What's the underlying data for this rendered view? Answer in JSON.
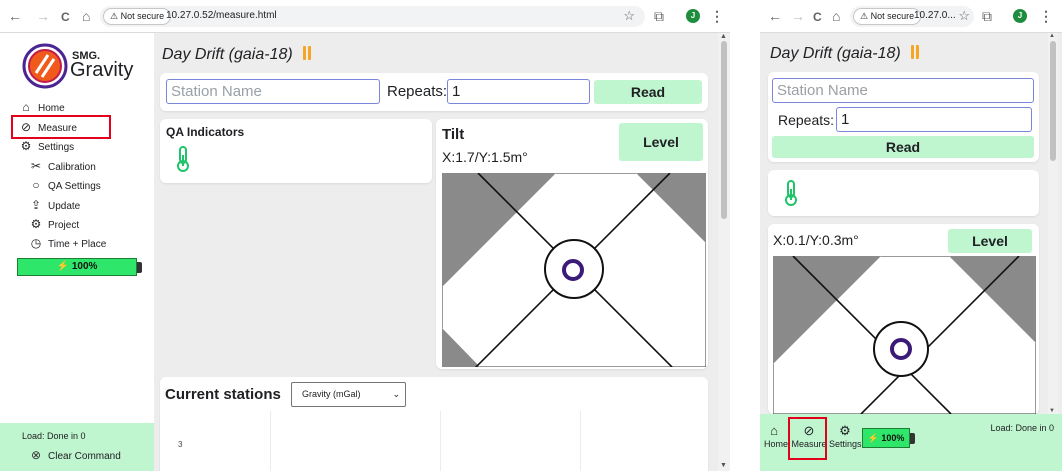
{
  "browser": {
    "back_icon": "←",
    "forward_icon": "→",
    "reload_icon": "C",
    "home_icon": "⌂",
    "security_chip": "⚠ Not secure",
    "url_full": "10.27.0.52/measure.html",
    "url_truncated": "10.27.0...",
    "star_icon": "☆",
    "extensions_icon": "⧉",
    "avatar_letter": "J",
    "menu_icon": "⋮"
  },
  "sidebar": {
    "brand_line1": "SMG.",
    "brand_line2": "Gravity",
    "items": [
      {
        "icon": "⌂",
        "label": "Home"
      },
      {
        "icon": "⊘",
        "label": "Measure"
      },
      {
        "icon": "⚙",
        "label": "Settings"
      }
    ],
    "sub_items": [
      {
        "icon": "✂",
        "label": "Calibration"
      },
      {
        "icon": "○",
        "label": "QA Settings"
      },
      {
        "icon": "⇪",
        "label": "Update"
      },
      {
        "icon": "⚙",
        "label": "Project"
      },
      {
        "icon": "◷",
        "label": "Time + Place"
      }
    ],
    "battery": "⚡ 100%",
    "load_status": "Load: Done in 0",
    "clear_command_icon": "⊗",
    "clear_command": "Clear Command"
  },
  "main": {
    "title": "Day Drift (gaia-18)",
    "station_placeholder": "Station Name",
    "repeats_label": "Repeats:",
    "repeats_value": "1",
    "read_button": "Read",
    "qa_title": "QA Indicators",
    "tilt_title": "Tilt",
    "level_button": "Level",
    "tilt_readout": "X:1.7/Y:1.5m°",
    "current_stations_title": "Current stations",
    "units_select": "Gravity (mGal)",
    "chart_tick": "3"
  },
  "mobile": {
    "title": "Day Drift (gaia-18)",
    "station_placeholder": "Station Name",
    "repeats_label": "Repeats:",
    "repeats_value": "1",
    "read_button": "Read",
    "tilt_readout": "X:0.1/Y:0.3m°",
    "level_button": "Level",
    "nav": [
      {
        "icon": "⌂",
        "label": "Home"
      },
      {
        "icon": "⊘",
        "label": "Measure"
      },
      {
        "icon": "⚙",
        "label": "Settings"
      }
    ],
    "battery": "⚡ 100%",
    "load_status": "Load: Done in 0"
  },
  "colors": {
    "accent_green": "#2ee66a",
    "button_green": "#bff5cf",
    "highlight_red": "#e3001b",
    "thermometer_green": "#1fc46b",
    "bubble_purple": "#3b1a78",
    "brand_purple": "#4b2591",
    "brand_orange": "#f05a1a"
  }
}
